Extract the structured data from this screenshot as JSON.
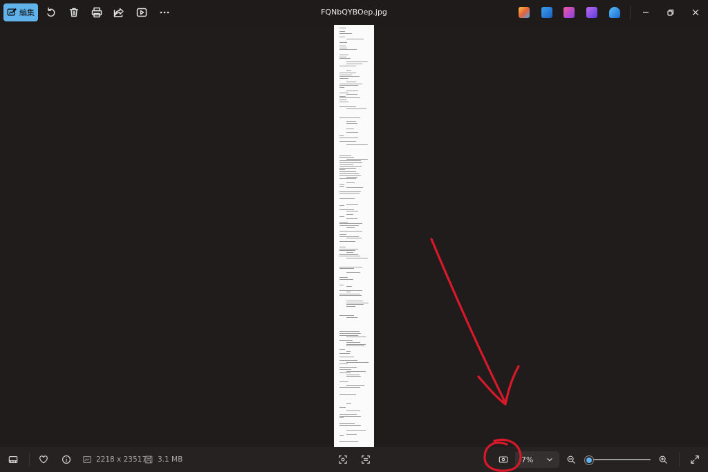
{
  "toolbar": {
    "edit_label": "編集",
    "icons": [
      "edit-image-icon",
      "rotate-icon",
      "delete-icon",
      "print-icon",
      "share-icon",
      "slideshow-icon",
      "more-icon"
    ]
  },
  "window": {
    "title": "FQNbQYBOep.jpg"
  },
  "apps": [
    {
      "name": "copilot-icon",
      "color": "#e8a33a"
    },
    {
      "name": "designer-icon",
      "color": "#3a8de0"
    },
    {
      "name": "clipchamp-icon",
      "color": "#c84de0"
    },
    {
      "name": "clip-icon",
      "color": "#7b4ee0"
    },
    {
      "name": "onedrive-icon",
      "color": "#2f8fe0"
    }
  ],
  "statusbar": {
    "dimensions": "2218 x 23517",
    "file_size": "3.1 MB",
    "zoom": "7%",
    "zoom_level_fraction": 0.0
  },
  "colors": {
    "accent": "#5fb2ea",
    "annotation": "#d9182a",
    "background": "#201c1b"
  }
}
